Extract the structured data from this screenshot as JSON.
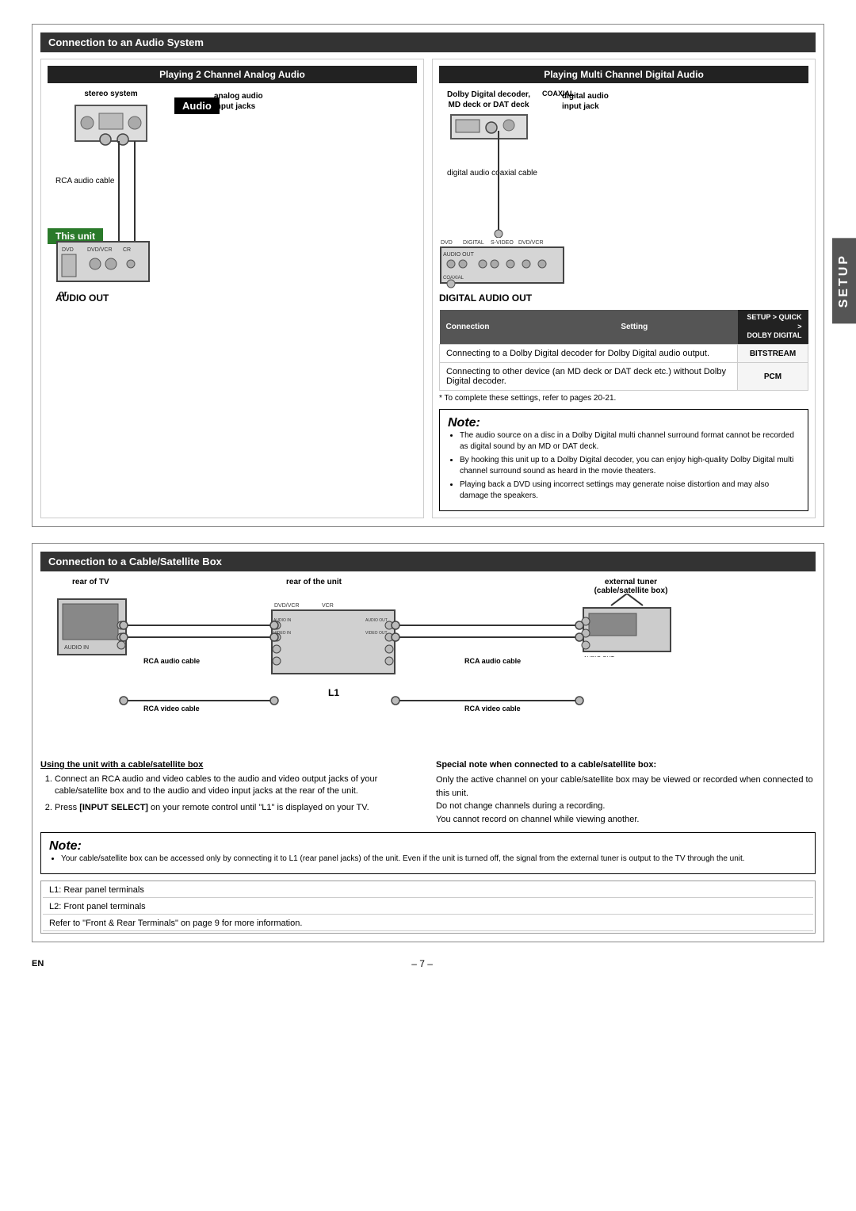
{
  "page": {
    "section1_title": "Connection to an Audio System",
    "section2_title": "Connection to a Cable/Satellite Box",
    "setup_tab": "SETUP",
    "page_number": "– 7 –",
    "en_label": "EN"
  },
  "audio_section": {
    "left_col_title": "Playing 2 Channel Analog Audio",
    "right_col_title": "Playing Multi Channel Digital Audio",
    "audio_badge": "Audio",
    "this_unit_badge": "This unit",
    "stereo_label": "stereo system",
    "analog_audio_label": "analog audio\ninput jacks",
    "rca_cable_label": "RCA audio cable",
    "audio_out_label": "AUDIO OUT",
    "dolby_decoder_label": "Dolby Digital decoder,\nMD deck or DAT deck",
    "digital_audio_label": "digital audio\ninput jack",
    "digital_coax_label": "digital audio coaxial cable",
    "digital_audio_out_label": "DIGITAL AUDIO OUT",
    "or_text": "or",
    "coaxial_label": "COAXIAL"
  },
  "settings_table": {
    "col1_header": "Connection",
    "col2_header": "Setting",
    "col3_header": "SETUP > QUICK >\nDOLBY DIGITAL",
    "row1_desc": "Connecting to a Dolby Digital decoder for Dolby Digital audio output.",
    "row1_value": "BITSTREAM",
    "row2_desc": "Connecting to other device (an MD deck or DAT deck etc.) without Dolby Digital decoder.",
    "row2_value": "PCM",
    "settings_note": "* To complete these settings, refer to pages 20-21."
  },
  "note1": {
    "title": "Note:",
    "bullets": [
      "The audio source on a disc in a Dolby Digital multi channel surround format cannot be recorded as digital sound by an MD or DAT deck.",
      "By hooking this unit up to a Dolby Digital decoder, you can enjoy high-quality Dolby Digital multi channel surround sound as heard in the movie theaters.",
      "Playing back a DVD using incorrect settings may generate noise distortion and may also damage the speakers."
    ]
  },
  "cable_section": {
    "rear_tv_label": "rear of TV",
    "rear_unit_label": "rear of the unit",
    "ext_tuner_label": "external tuner\n(cable/satellite box)",
    "l1_label": "L1",
    "rca_audio_cable1": "RCA audio cable",
    "rca_video_cable1": "RCA video cable",
    "rca_audio_cable2": "RCA audio cable",
    "rca_video_cable2": "RCA video cable",
    "dvd_vcr_label": "DVD/VCR",
    "using_title": "Using the unit with a cable/satellite box",
    "step1": "Connect an RCA audio and video cables to the audio and video output jacks of your cable/satellite box and to the audio and video input jacks at the rear of the unit.",
    "step2_part1": "Press ",
    "step2_bold": "[INPUT SELECT]",
    "step2_part2": " on your remote control until \"L1\" is displayed on your TV."
  },
  "special_note": {
    "title": "Special note when connected to a cable/satellite box:",
    "lines": [
      "Only the active channel on your cable/satellite box may be viewed or recorded when connected to this unit.",
      "Do not change channels during a recording.",
      "You cannot record on channel while viewing another."
    ]
  },
  "note2": {
    "title": "Note:",
    "bullets": [
      "Your cable/satellite box can be accessed only by connecting it to L1 (rear panel jacks) of the unit. Even if the unit is turned off, the signal from the external tuner is output to the TV through the unit."
    ]
  },
  "terminal_table": {
    "l1": "L1:   Rear panel terminals",
    "l2": "L2:   Front panel terminals",
    "refer": "Refer to \"Front & Rear Terminals\" on page 9 for more information."
  }
}
